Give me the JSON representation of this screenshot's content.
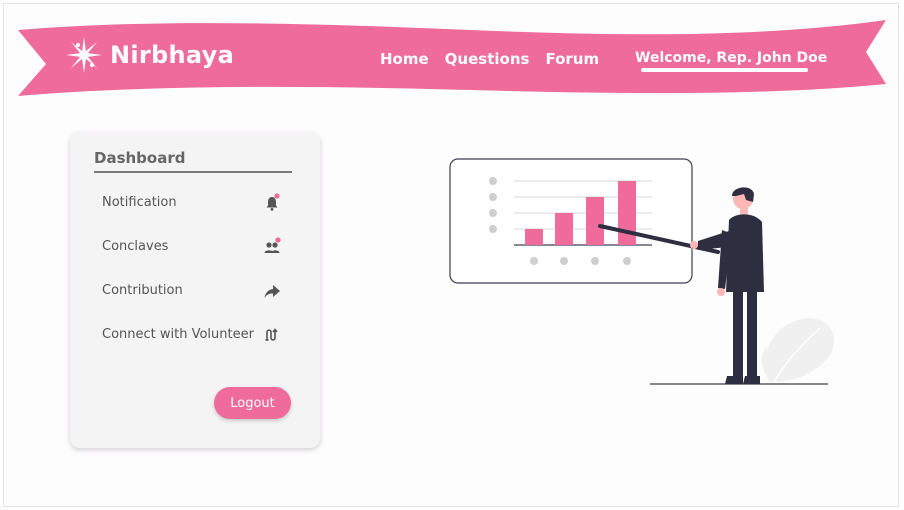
{
  "app": {
    "name": "Nirbhaya"
  },
  "nav": {
    "items": [
      {
        "label": "Home"
      },
      {
        "label": "Questions"
      },
      {
        "label": "Forum"
      }
    ],
    "welcome": "Welcome, Rep. John Doe"
  },
  "dashboard": {
    "title": "Dashboard",
    "items": [
      {
        "label": "Notification",
        "icon": "bell-icon",
        "has_badge": true
      },
      {
        "label": "Conclaves",
        "icon": "people-icon",
        "has_badge": true
      },
      {
        "label": "Contribution",
        "icon": "share-arrow-icon",
        "has_badge": false
      },
      {
        "label": "Connect with Volunteer",
        "icon": "connect-route-icon",
        "has_badge": false
      }
    ],
    "logout_label": "Logout"
  },
  "colors": {
    "brand_pink": "#ee6b9a",
    "text_gray": "#555555",
    "card_bg": "#f4f4f4"
  }
}
